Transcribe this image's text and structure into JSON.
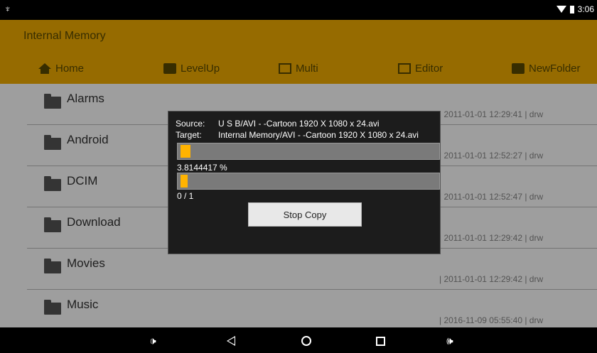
{
  "status_bar": {
    "time": "3:06",
    "usb_glyph": "♆"
  },
  "app": {
    "title": "Internal Memory",
    "toolbar": {
      "home": "Home",
      "levelup": "LevelUp",
      "multi": "Multi",
      "editor": "Editor",
      "newfolder": "NewFolder"
    },
    "files": [
      {
        "name": "Alarms",
        "meta": "| 2011-01-01 12:29:41 | drw"
      },
      {
        "name": "Android",
        "meta": "| 2011-01-01 12:52:27 | drw"
      },
      {
        "name": "DCIM",
        "meta": "| 2011-01-01 12:52:47 | drw"
      },
      {
        "name": "Download",
        "meta": "| 2011-01-01 12:29:42 | drw"
      },
      {
        "name": "Movies",
        "meta": "| 2011-01-01 12:29:42 | drw"
      },
      {
        "name": "Music",
        "meta": "| 2016-11-09 05:55:40 | drw"
      }
    ]
  },
  "dialog": {
    "source_label": "Source:",
    "source_value": "U S B/AVI -  -Cartoon 1920 X 1080 x 24.avi",
    "target_label": "Target:",
    "target_value": "Internal Memory/AVI -  -Cartoon 1920 X 1080 x 24.avi",
    "file_progress_text": "3.8144417 %",
    "file_progress_fraction": 0.038,
    "count_text": "0 / 1",
    "count_progress_fraction": 0.0,
    "stop_label": "Stop Copy"
  },
  "nav_bar": {
    "vol_down_glyph": "🕩",
    "vol_up_glyph": "🕪"
  },
  "icons": [
    "usb-icon",
    "wifi-icon",
    "battery-icon",
    "home-icon",
    "levelup-icon",
    "multi-icon",
    "editor-icon",
    "newfolder-icon",
    "folder-icon",
    "back-icon",
    "home-nav-icon",
    "recents-icon",
    "volume-down-icon",
    "volume-up-icon"
  ],
  "colors": {
    "accent": "#f2ad00",
    "progress": "#ffb300"
  }
}
